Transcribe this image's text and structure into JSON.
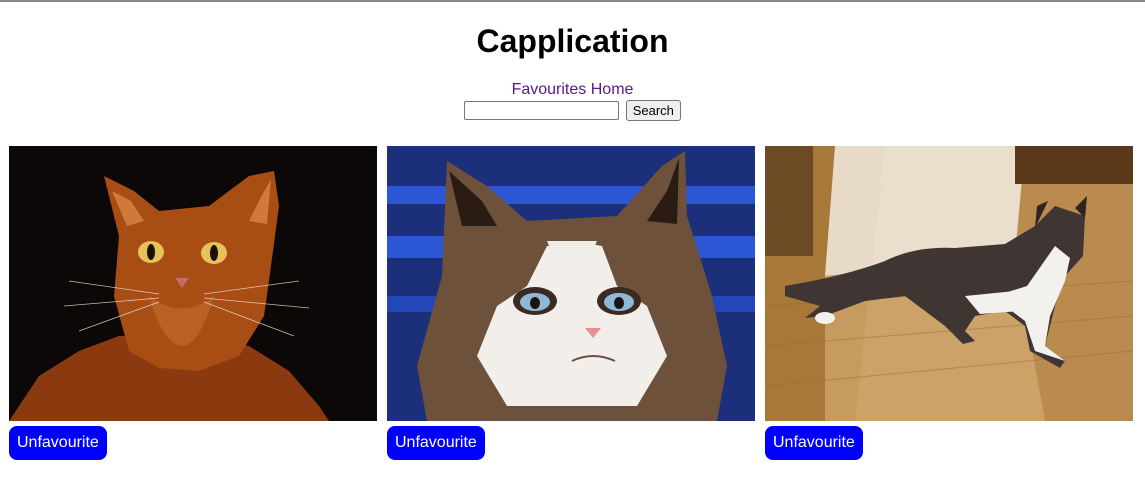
{
  "app": {
    "title": "Capplication"
  },
  "nav": {
    "favourites": "Favourites",
    "home": "Home"
  },
  "search": {
    "value": "",
    "placeholder": "",
    "button_label": "Search"
  },
  "cats": [
    {
      "photo": "orange-somali-cat-photo",
      "button_label": "Unfavourite"
    },
    {
      "photo": "grumpy-cat-photo",
      "button_label": "Unfavourite"
    },
    {
      "photo": "tabby-white-cat-on-floor-photo",
      "button_label": "Unfavourite"
    }
  ],
  "colors": {
    "button_bg": "#0000ff",
    "link": "#551a8b"
  }
}
